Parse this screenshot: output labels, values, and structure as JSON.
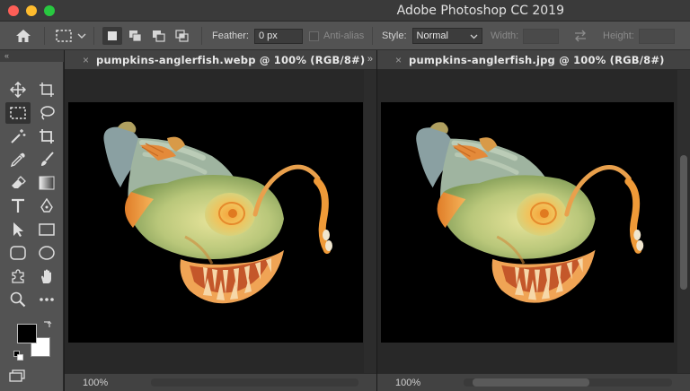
{
  "window": {
    "title": "Adobe Photoshop CC 2019"
  },
  "options_bar": {
    "feather_label": "Feather:",
    "feather_value": "0 px",
    "antialias_label": "Anti-alias",
    "style_label": "Style:",
    "style_value": "Normal",
    "width_label": "Width:",
    "height_label": "Height:"
  },
  "toolbox": {
    "header": "«",
    "foreground_color": "#000000",
    "background_color": "#ffffff"
  },
  "documents": [
    {
      "title": "pumpkins-anglerfish.webp @ 100% (RGB/8#)",
      "zoom": "100%"
    },
    {
      "title": "pumpkins-anglerfish.jpg @ 100% (RGB/8#)",
      "zoom": "100%"
    }
  ],
  "panel_expand_glyph": "»",
  "close_glyph": "×"
}
